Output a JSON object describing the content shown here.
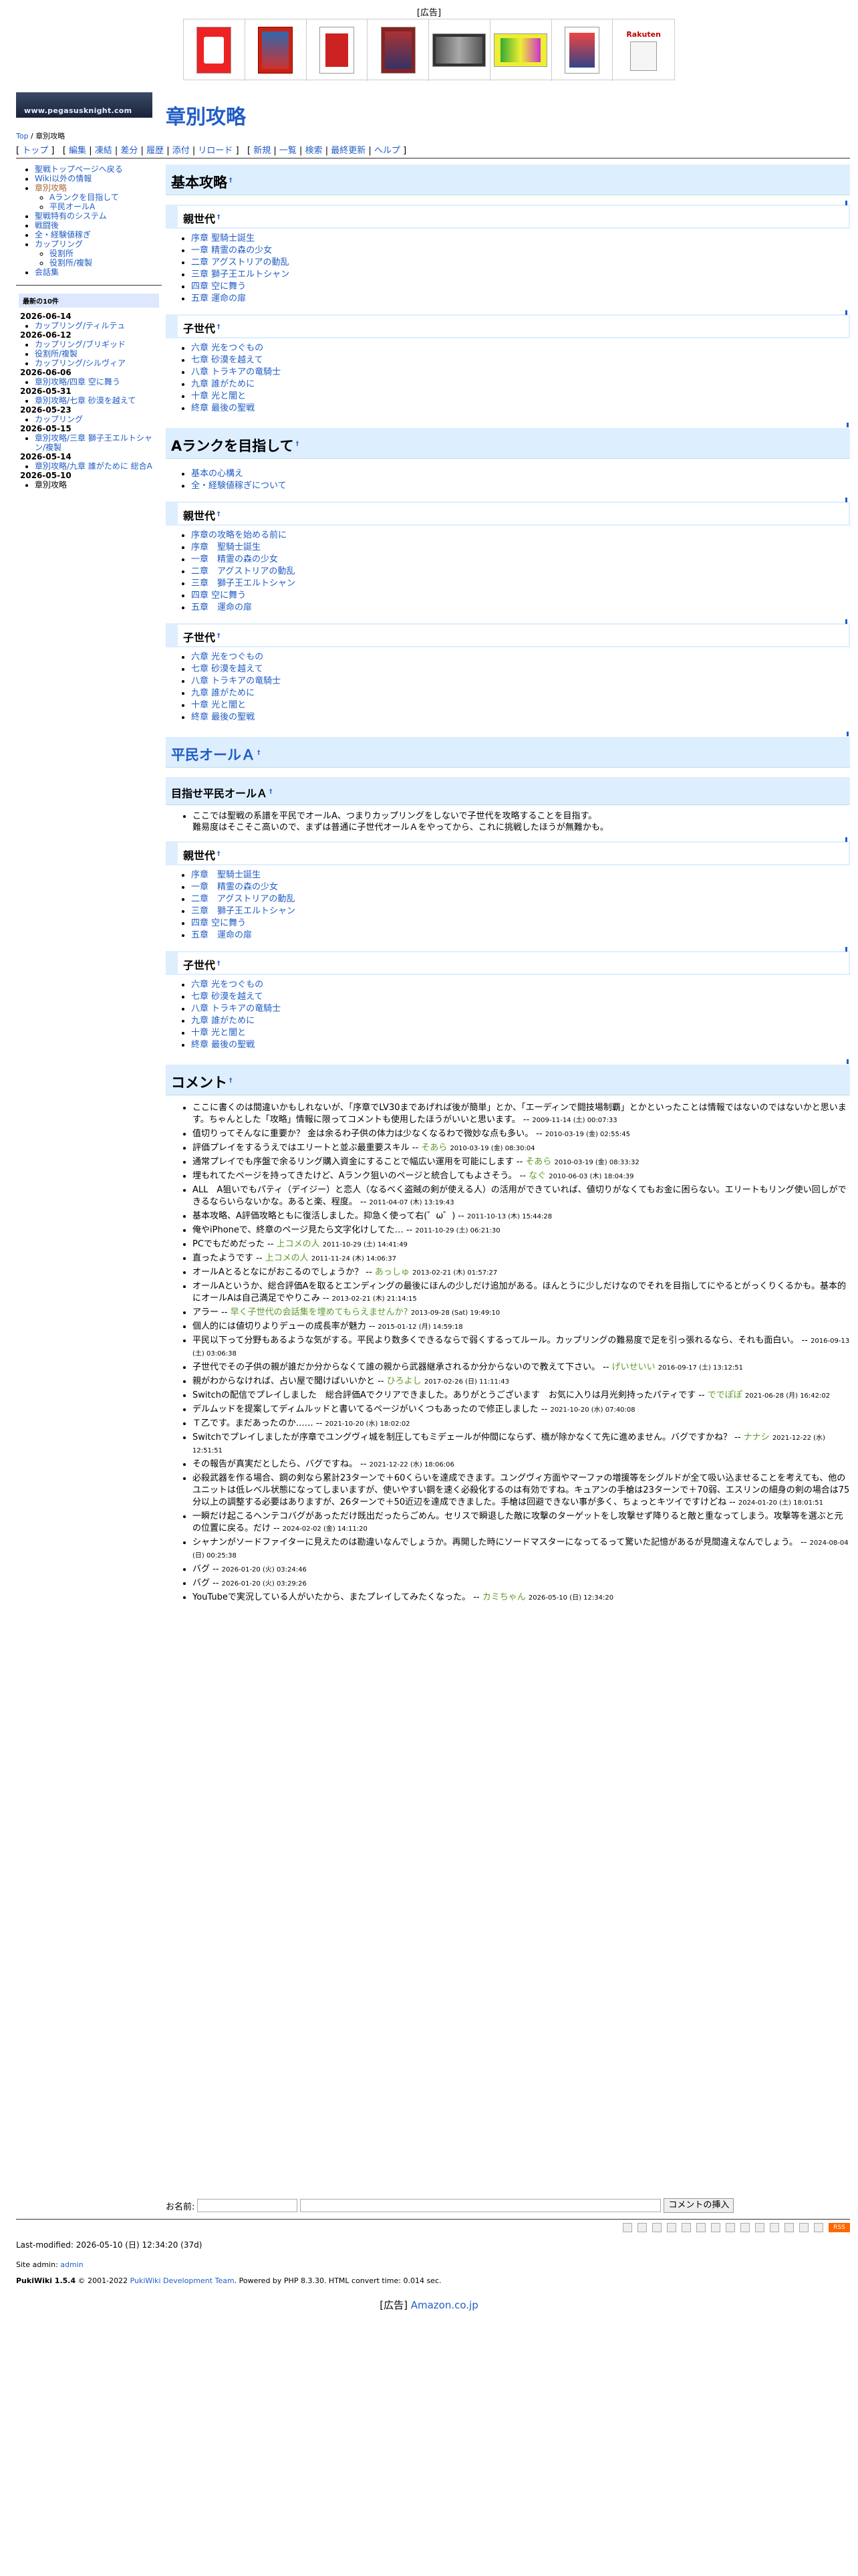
{
  "ad_top": {
    "label": "[広告]",
    "rakuten": "Rakuten"
  },
  "site": {
    "logo_text": "www.pegasusknight.com"
  },
  "page": {
    "title": "章別攻略",
    "crumb_top": "Top",
    "crumb_page": "章別攻略"
  },
  "nav": {
    "items": [
      "トップ",
      "編集",
      "凍結",
      "差分",
      "履歴",
      "添付",
      "リロード",
      "新規",
      "一覧",
      "検索",
      "最終更新",
      "ヘルプ"
    ]
  },
  "menu": {
    "items": [
      "聖戦トップページへ戻る",
      "Wiki以外の情報",
      "章別攻略"
    ],
    "sub1": [
      "Aランクを目指して",
      "平民オールA"
    ],
    "items2": [
      "聖戦特有のシステム",
      "戦闘後",
      "全・経験値稼ぎ",
      "カップリング"
    ],
    "sub2": [
      "役割所",
      "役割所/複製"
    ],
    "items3": [
      "会話集"
    ],
    "recent_title": "最新の10件",
    "recent": [
      {
        "date": "2026-06-14",
        "items": [
          "カップリング/ティルテュ"
        ]
      },
      {
        "date": "2026-06-12",
        "items": [
          "カップリング/ブリギッド",
          "役割所/複製",
          "カップリング/シルヴィア"
        ]
      },
      {
        "date": "2026-06-06",
        "items": [
          "章別攻略/四章 空に舞う"
        ]
      },
      {
        "date": "2026-05-31",
        "items": [
          "章別攻略/七章 砂漠を越えて"
        ]
      },
      {
        "date": "2026-05-23",
        "items": [
          "カップリング"
        ]
      },
      {
        "date": "2026-05-15",
        "items": [
          "章別攻略/三章 獅子王エルトシャン/複製"
        ]
      },
      {
        "date": "2026-05-14",
        "items": [
          "章別攻略/九章 誰がために 総合A"
        ]
      },
      {
        "date": "2026-05-10",
        "items": [
          "章別攻略"
        ]
      }
    ]
  },
  "sections": {
    "basic": {
      "title": "基本攻略",
      "parent": {
        "title": "親世代",
        "items": [
          "序章 聖騎士誕生",
          "一章 精霊の森の少女",
          "二章 アグストリアの動乱",
          "三章 獅子王エルトシャン",
          "四章 空に舞う",
          "五章 運命の扉"
        ]
      },
      "child": {
        "title": "子世代",
        "items": [
          "六章 光をつぐもの",
          "七章 砂漠を越えて",
          "八章 トラキアの竜騎士",
          "九章 誰がために",
          "十章 光と闇と",
          "終章 最後の聖戦"
        ]
      }
    },
    "arank": {
      "title": "Aランクを目指して",
      "links": [
        "基本の心構え",
        "全・経験値稼ぎについて"
      ],
      "parent": {
        "title": "親世代",
        "items": [
          "序章の攻略を始める前に",
          "序章　聖騎士誕生",
          "一章　精霊の森の少女",
          "二章　アグストリアの動乱",
          "三章　獅子王エルトシャン",
          "四章 空に舞う",
          "五章　運命の扉"
        ]
      },
      "child": {
        "title": "子世代",
        "items": [
          "六章 光をつぐもの",
          "七章 砂漠を越えて",
          "八章 トラキアの竜騎士",
          "九章 誰がために",
          "十章 光と闇と",
          "終章 最後の聖戦"
        ]
      }
    },
    "commoner": {
      "title": "平民オールＡ",
      "goal": {
        "title": "目指せ平民オールＡ",
        "text1": "ここでは聖戦の系譜を平民でオールA、つまりカップリングをしないで子世代を攻略することを目指す。",
        "text2": "難易度はそこそこ高いので、まずは普通に子世代オールＡをやってから、これに挑戦したほうが無難かも。"
      },
      "parent": {
        "title": "親世代",
        "items": [
          "序章　聖騎士誕生",
          "一章　精霊の森の少女",
          "二章　アグストリアの動乱",
          "三章　獅子王エルトシャン",
          "四章 空に舞う",
          "五章　運命の扉"
        ]
      },
      "child": {
        "title": "子世代",
        "items": [
          "六章 光をつぐもの",
          "七章 砂漠を越えて",
          "八章 トラキアの竜騎士",
          "九章 誰がために",
          "十章 光と闇と",
          "終章 最後の聖戦"
        ]
      }
    }
  },
  "comments": {
    "title": "コメント",
    "items": [
      {
        "text": "ここに書くのは間違いかもしれないが、「序章でLV30まであげれば後が簡単」とか、「エーディンで闘技場制覇」とかといったことは情報ではないのではないかと思います。ちゃんとした「攻略」情報に限ってコメントも使用したほうがいいと思います。",
        "author": "",
        "date": "2009-11-14 (土) 00:07:33"
      },
      {
        "text": "值切りってそんなに重要か？ 金は余るわ子供の体力は少なくなるわで微妙な点も多い。",
        "author": "",
        "date": "2010-03-19 (金) 02:55:45"
      },
      {
        "text": "評価プレイをするうえではエリートと並ぶ最重要スキル",
        "author": "そあら",
        "date": "2010-03-19 (金) 08:30:04"
      },
      {
        "text": "通常プレイでも序盤で余るリング購入資金にすることで幅広い運用を可能にします",
        "author": "そあら",
        "date": "2010-03-19 (金) 08:33:32"
      },
      {
        "text": "埋もれてたページを持ってきたけど、Aランク狙いのページと統合してもよさそう。",
        "author": "なぐ",
        "date": "2010-06-03 (木) 18:04:39"
      },
      {
        "text": "ALL　A狙いでもパティ（デイジー）と恋人（なるべく盗賊の剣が使える人）の活用ができていれば、値切りがなくてもお金に困らない。エリートもリング使い回しができるならいらないかな。あると楽、程度。",
        "author": "",
        "date": "2011-04-07 (木) 13:19:43"
      },
      {
        "text": "基本攻略、A評価攻略ともに復活しました。抑急く使って右(゜ω゜)",
        "author": "",
        "date": "2011-10-13 (木) 15:44:28"
      },
      {
        "text": "俺やiPhoneで、終章のページ見たら文字化けしてた…",
        "author": "",
        "date": "2011-10-29 (土) 06:21:30"
      },
      {
        "text": "PCでもだめだった",
        "author": "上コメの人",
        "date": "2011-10-29 (土) 14:41:49"
      },
      {
        "text": "直ったようです",
        "author": "上コメの人",
        "date": "2011-11-24 (木) 14:06:37"
      },
      {
        "text": "オールAとるとなにがおこるのでしょうか？",
        "author": "あっしゅ",
        "date": "2013-02-21 (木) 01:57:27"
      },
      {
        "text": "オールAというか、総合評価Aを取るとエンディングの最後にほんの少しだけ追加がある。ほんとうに少しだけなのでそれを目指してにやるとがっくりくるかも。基本的にオールAは自己満足でやりこみ",
        "author": "",
        "date": "2013-02-21 (木) 21:14:15"
      },
      {
        "text": "アラー",
        "author": "早く子世代の会話集を埋めてもらえませんか?",
        "date": "2013-09-28 (Sat) 19:49:10"
      },
      {
        "text": "個人的には値切りよりデューの成長率が魅力",
        "author": "",
        "date": "2015-01-12 (月) 14:59:18"
      },
      {
        "text": "平民以下って分野もあるような気がする。平民より数多くできるならで弱くするってルール。カップリングの難易度で足を引っ張れるなら、それも面白い。",
        "author": "",
        "date": "2016-09-13 (土) 03:06:38"
      },
      {
        "text": "子世代でその子供の親が誰だか分からなくて誰の親から武器継承されるか分からないので教えて下さい。",
        "author": "げいせいい",
        "date": "2016-09-17 (土) 13:12:51"
      },
      {
        "text": "親がわからなければ、占い屋で聞けばいいかと",
        "author": "ひろよし",
        "date": "2017-02-26 (日) 11:11:43"
      },
      {
        "text": "Switchの配信でプレイしました　総合評価Aでクリアできました。ありがとうございます　お気に入りは月光剣持ったパティです",
        "author": "ででぽぽ",
        "date": "2021-06-28 (月) 16:42:02"
      },
      {
        "text": "デルムッドを提案してディムルッドと書いてるページがいくつもあったので修正しました",
        "author": "",
        "date": "2021-10-20 (水) 07:40:08"
      },
      {
        "text": "Ｔ乙です。まだあったのか……",
        "author": "",
        "date": "2021-10-20 (水) 18:02:02"
      },
      {
        "text": "Switchでプレイしましたが序章でユングヴィ城を制圧してもミデェールが仲間にならず、橋が除かなくて先に進めません。バグですかね？",
        "author": "ナナシ",
        "date": "2021-12-22 (水) 12:51:51"
      },
      {
        "text": "その報告が真実だとしたら、バグですね。",
        "author": "",
        "date": "2021-12-22 (水) 18:06:06"
      },
      {
        "text": "必殺武器を作る場合、鋼の剣なら累計23ターンで＋60くらいを達成できます。ユングヴィ方面やマーファの増援等をシグルドが全て吸い込ませることを考えても、他のユニットは低レベル状態になってしまいますが、使いやすい鋼を速く必殺化するのは有効ですね。キュアンの手槍は23ターンで＋70弱、エスリンの細身の剣の場合は75分以上の調整する必要はありますが、26ターンで＋50近辺を達成できました。手槍は回避できない事が多く、ちょっとキツイですけどね",
        "author": "",
        "date": "2024-01-20 (土) 18:01:51"
      },
      {
        "text": "一瞬だけ起こるヘンテコバグがあっただけ既出だったらごめん。セリスで瞬退した敵に攻撃のターゲットをし攻撃せず降りると敵と重なってしまう。攻撃等を選ぶと元の位置に戻る。だけ",
        "author": "",
        "date": "2024-02-02 (金) 14:11:20"
      },
      {
        "text": "シャナンがソードファイターに見えたのは勘違いなんでしょうか。再開した時にソードマスターになってるって驚いた記憶があるが見間違えなんでしょう。",
        "author": "",
        "date": "2024-08-04 (日) 00:25:38"
      },
      {
        "text": "バグ",
        "author": "",
        "date": "2026-01-20 (火) 03:24:46"
      },
      {
        "text": "バグ",
        "author": "",
        "date": "2026-01-20 (火) 03:29:26"
      },
      {
        "text": "YouTubeで実況している人がいたから、またプレイしてみたくなった。",
        "author": "カミちゃん",
        "date": "2026-05-10 (日) 12:34:20"
      }
    ]
  },
  "comment_form": {
    "name_label": "お名前:",
    "submit": "コメントの挿入"
  },
  "footer": {
    "lastmod": "Last-modified: 2026-05-10 (日) 12:34:20 (37d)",
    "admin_label": "Site admin:",
    "admin": "admin",
    "credit1": "PukiWiki 1.5.4",
    "credit2": "© 2001-2022",
    "credit3": "PukiWiki Development Team",
    "credit4": ". Powered by PHP 8.3.30. HTML convert time: 0.014 sec.",
    "rss": "RSS"
  },
  "ad_bottom": {
    "label": "[広告]",
    "link": "Amazon.co.jp"
  }
}
